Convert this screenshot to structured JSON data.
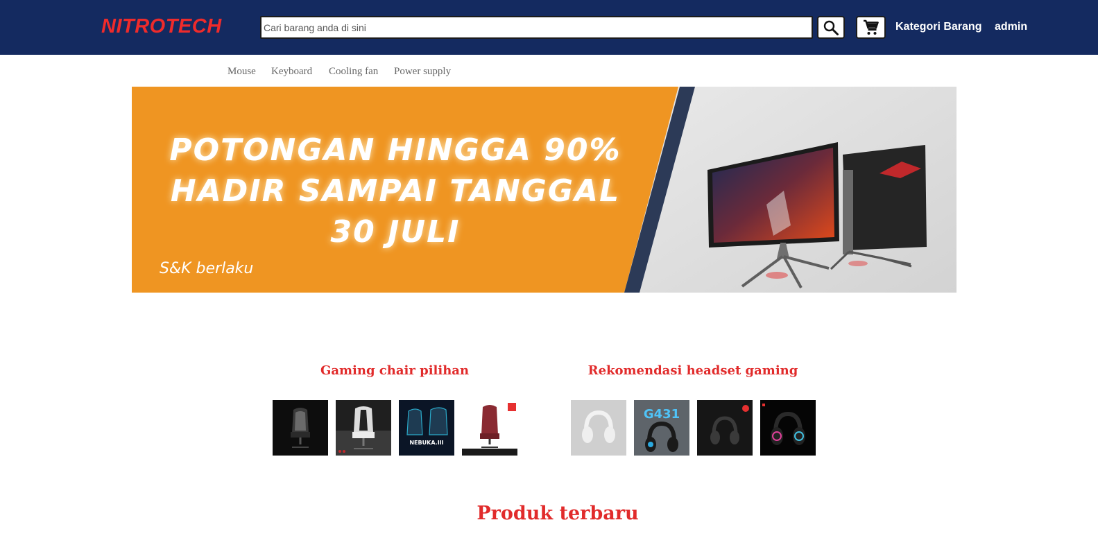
{
  "header": {
    "logo": "NITROTECH",
    "search_placeholder": "Cari barang anda di sini",
    "search_icon": "search-icon",
    "cart_icon": "cart-icon",
    "nav": [
      "Kategori Barang",
      "admin"
    ]
  },
  "categories": [
    "Mouse",
    "Keyboard",
    "Cooling fan",
    "Power supply"
  ],
  "banner": {
    "lines": [
      "Potongan hingga 90%",
      "hadir sampai tanggal",
      "30 Juli"
    ],
    "note": "S&K berlaku"
  },
  "sections": {
    "chairs": {
      "title": "Gaming chair pilihan",
      "item_count": 4
    },
    "headsets": {
      "title": "Rekomendasi headset gaming",
      "item_count": 4
    }
  },
  "latest_title": "Produk terbaru",
  "colors": {
    "header_bg": "#142a60",
    "brand_red": "#e12b2b",
    "banner_orange": "#ef9522"
  }
}
